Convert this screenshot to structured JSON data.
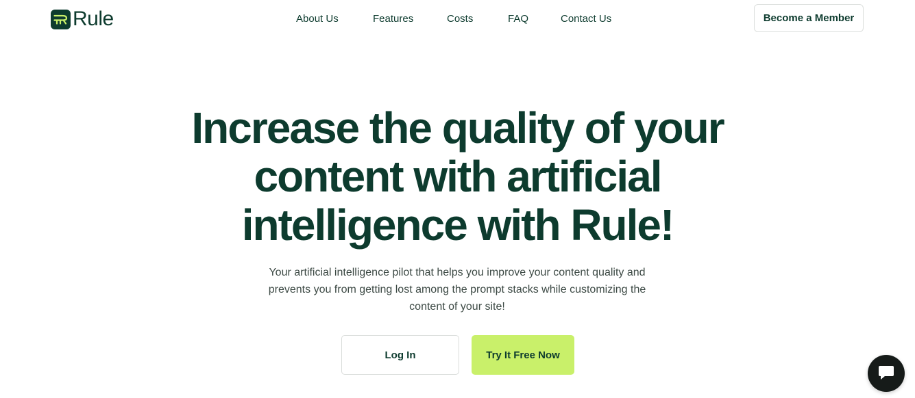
{
  "brand": {
    "name": "Rule",
    "primary_color": "#0d3b2e",
    "accent_color": "#c9f06a"
  },
  "nav": {
    "items": [
      {
        "label": "About Us"
      },
      {
        "label": "Features"
      },
      {
        "label": "Costs"
      },
      {
        "label": "FAQ"
      },
      {
        "label": "Contact Us"
      }
    ],
    "cta_label": "Become a Member"
  },
  "hero": {
    "title_lines": [
      "Increase the quality of your",
      "content with artificial",
      "intelligence with Rule!"
    ],
    "subtitle_lines": [
      "Your artificial intelligence pilot that helps you improve your content quality and",
      "prevents you from getting lost among the prompt stacks while customizing the",
      "content of your site!"
    ],
    "login_label": "Log In",
    "try_label": "Try It Free Now"
  },
  "chat": {
    "icon": "chat-bubble-icon"
  }
}
